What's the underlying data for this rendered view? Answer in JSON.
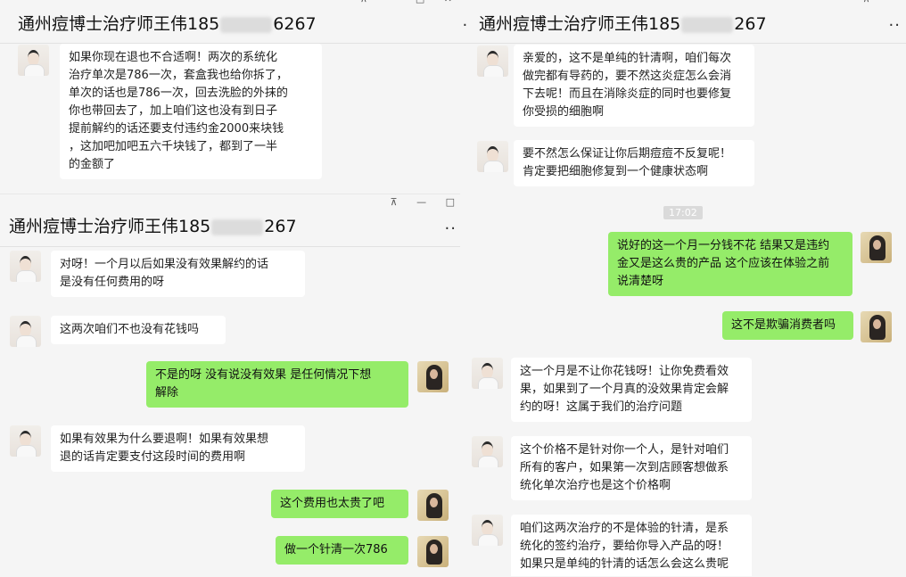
{
  "panel_a": {
    "title_prefix": "通州痘博士治疗师王伟185",
    "title_suffix": "6267",
    "more": "...",
    "messages": [
      {
        "side": "in",
        "text": "如果你现在退也不合适啊！两次的系统化\n治疗单次是786一次，套盒我也给你拆了，\n单次的话也是786一次，回去洗脸的外抹的\n你也带回去了，加上咱们这也没有到日子\n提前解约的话还要支付违约金2000来块钱\n，这加吧加吧五六千块钱了，都到了一半\n的金额了"
      }
    ]
  },
  "panel_b": {
    "title_prefix": "通州痘博士治疗师王伟185",
    "title_suffix": "267",
    "more": "...",
    "messages": [
      {
        "side": "in",
        "text": "亲爱的，这不是单纯的针清啊，咱们每次\n做完都有导药的，要不然这炎症怎么会消\n下去呢！而且在消除炎症的同时也要修复\n你受损的细胞啊"
      },
      {
        "side": "in",
        "text": "要不然怎么保证让你后期痘痘不反复呢！\n肯定要把细胞修复到一个健康状态啊"
      },
      {
        "side": "time",
        "text": "17:02"
      },
      {
        "side": "out",
        "text": "说好的这一个月一分钱不花 结果又是违约\n金又是这么贵的产品 这个应该在体验之前\n说清楚呀"
      },
      {
        "side": "out",
        "text": "这不是欺骗消费者吗"
      },
      {
        "side": "in",
        "text": "这一个月是不让你花钱呀！让你免费看效\n果，如果到了一个月真的没效果肯定会解\n约的呀！这属于我们的治疗问题"
      },
      {
        "side": "in",
        "text": "这个价格不是针对你一个人，是针对咱们\n所有的客户，如果第一次到店顾客想做系\n统化单次治疗也是这个价格啊"
      },
      {
        "side": "in",
        "text": "咱们这两次治疗的不是体验的针清，是系\n统化的签约治疗，要给你导入产品的呀！\n如果只是单纯的针清的话怎么会这么贵呢"
      }
    ]
  },
  "panel_c": {
    "title_prefix": "通州痘博士治疗师王伟185",
    "title_suffix": "267",
    "more": "..",
    "messages": [
      {
        "side": "in",
        "text": "对呀！一个月以后如果没有效果解约的话\n是没有任何费用的呀"
      },
      {
        "side": "in",
        "text": "这两次咱们不也没有花钱吗"
      },
      {
        "side": "out",
        "text": "不是的呀 没有说没有效果 是任何情况下想\n解除"
      },
      {
        "side": "in",
        "text": "如果有效果为什么要退啊！如果有效果想\n退的话肯定要支付这段时间的费用啊"
      },
      {
        "side": "out",
        "text": "这个费用也太贵了吧"
      },
      {
        "side": "out",
        "text": "做一个针清一次786"
      }
    ]
  },
  "window_controls": {
    "pin": "⊼",
    "minimize": "—",
    "maximize": "□",
    "close": "✕"
  }
}
